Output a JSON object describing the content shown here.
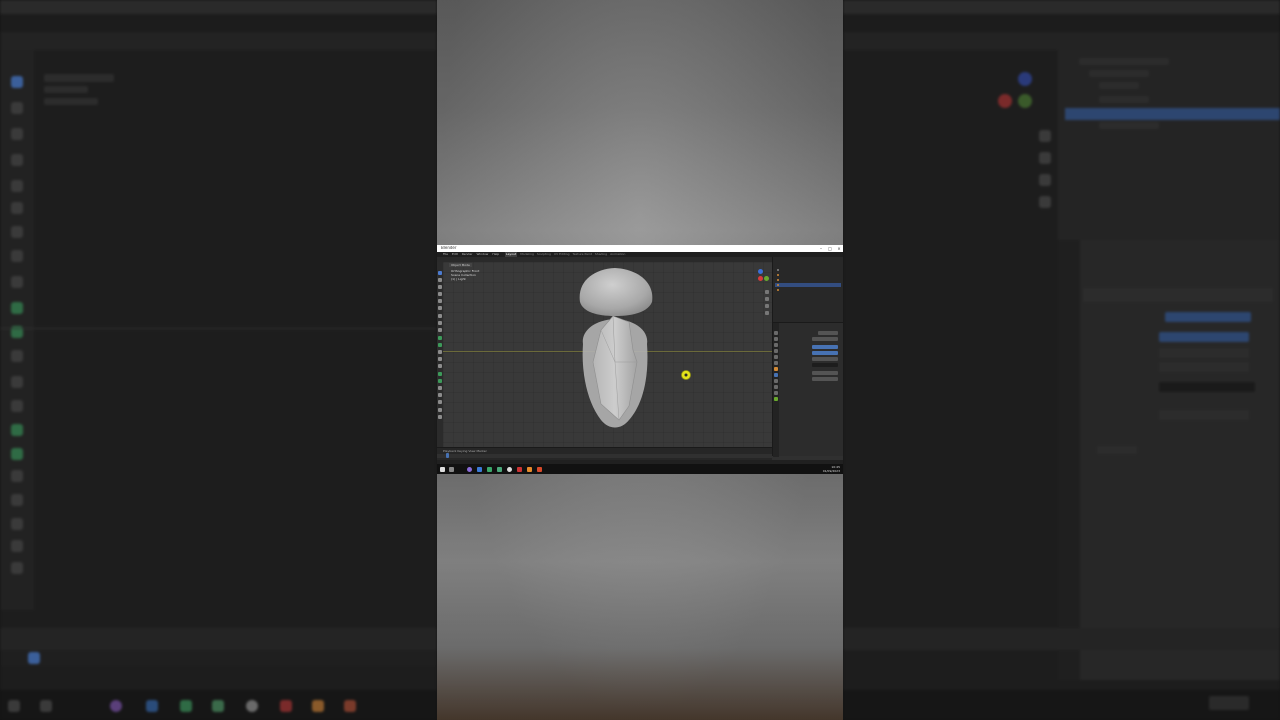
{
  "window": {
    "title": "Blender",
    "menus": [
      "File",
      "Edit",
      "Render",
      "Window",
      "Help"
    ],
    "workspaces": [
      "Layout",
      "Modeling",
      "Sculpting",
      "UV Editing",
      "Texture Paint",
      "Shading",
      "Animation"
    ],
    "active_workspace": "Layout"
  },
  "viewport": {
    "mode": "Object Mode",
    "info_lines": [
      "Orthographic Front",
      "Scene Collection",
      "(1) | Light"
    ]
  },
  "timeline": {
    "label": "Playback  Keying  View  Marker"
  },
  "taskbar": {
    "time": "10:45",
    "date": "01/09/2023"
  },
  "colors": {
    "accent": "#4772b3",
    "selection": "#334d80",
    "light": "#e3e31a",
    "axis_x": "#d83b3b",
    "axis_y": "#6aa92e",
    "axis_z": "#3b6fd8"
  }
}
